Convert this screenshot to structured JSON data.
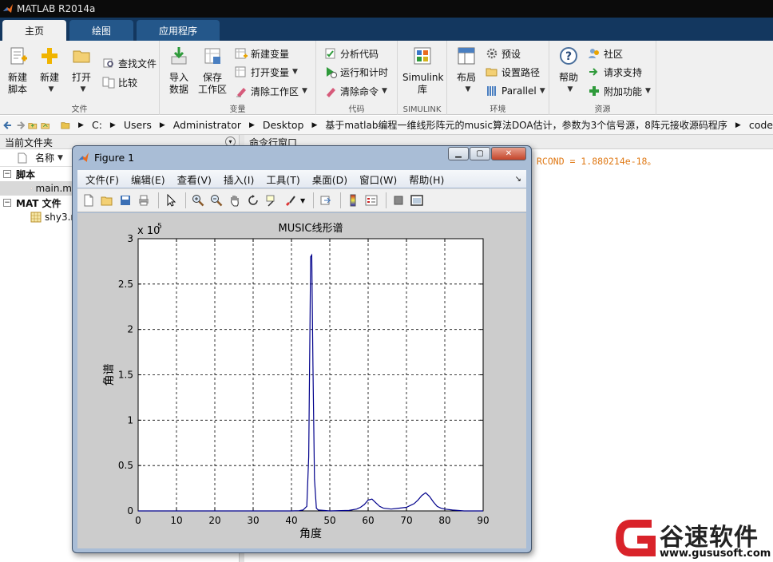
{
  "app": {
    "title": "MATLAB R2014a"
  },
  "tabs": [
    "主页",
    "绘图",
    "应用程序"
  ],
  "ribbon": {
    "file_group": {
      "title": "文件",
      "new_script": "新建\n脚本",
      "new": "新建",
      "open": "打开",
      "find_files": "查找文件",
      "compare": "比较"
    },
    "variable_group": {
      "title": "变量",
      "import": "导入\n数据",
      "save_workspace": "保存\n工作区",
      "new_variable": "新建变量",
      "open_variable": "打开变量",
      "clear_workspace": "清除工作区"
    },
    "code_group": {
      "title": "代码",
      "analyze": "分析代码",
      "run_time": "运行和计时",
      "clear_commands": "清除命令"
    },
    "simulink_group": {
      "title": "SIMULINK",
      "simulink_lib": "Simulink\n库"
    },
    "env_group": {
      "title": "环境",
      "layout": "布局",
      "prefs": "预设",
      "set_path": "设置路径",
      "parallel": "Parallel"
    },
    "res_group": {
      "title": "资源",
      "help": "帮助",
      "community": "社区",
      "support": "请求支持",
      "addons": "附加功能"
    }
  },
  "address": {
    "segments": [
      "C:",
      "Users",
      "Administrator",
      "Desktop",
      "基于matlab编程一维线形阵元的music算法DOA估计，参数为3个信号源，8阵元接收源码程序",
      "code"
    ]
  },
  "left_panel": {
    "title": "当前文件夹",
    "col_name": "名称",
    "groups": [
      {
        "label": "脚本",
        "files": [
          "main.m"
        ]
      },
      {
        "label": "MAT 文件",
        "files": [
          "shy3.mat"
        ]
      }
    ]
  },
  "command_window": {
    "title": "命令行窗口",
    "line": "RCOND =  1.880214e-18。"
  },
  "figure": {
    "title": "Figure 1",
    "menu": [
      "文件(F)",
      "编辑(E)",
      "查看(V)",
      "插入(I)",
      "工具(T)",
      "桌面(D)",
      "窗口(W)",
      "帮助(H)"
    ],
    "toolbar_icons": [
      "new-figure-icon",
      "open-icon",
      "save-icon",
      "print-icon",
      "pointer-icon",
      "zoom-in-icon",
      "zoom-out-icon",
      "pan-icon",
      "rotate-icon",
      "data-cursor-icon",
      "brush-icon",
      "link-icon",
      "colorbar-icon",
      "legend-icon",
      "hide-tools-icon",
      "dock-icon"
    ]
  },
  "chart_data": {
    "type": "line",
    "title": "MUSIC线形谱",
    "xlabel": "角度",
    "ylabel": "角谱",
    "exponent_label": "x 10",
    "exponent_power": "5",
    "xlim": [
      0,
      90
    ],
    "ylim": [
      0,
      3
    ],
    "xticks": [
      "0",
      "10",
      "20",
      "30",
      "40",
      "50",
      "60",
      "70",
      "80",
      "90"
    ],
    "yticks": [
      "0",
      "0.5",
      "1",
      "1.5",
      "2",
      "2.5",
      "3"
    ],
    "grid": true,
    "series": [
      {
        "color": "#00008b",
        "x": [
          0,
          20,
          40,
          42,
          43,
          44,
          44.5,
          45,
          45.3,
          45.6,
          46,
          46.5,
          47,
          50,
          55,
          57,
          58,
          59,
          60,
          61,
          62,
          63,
          64,
          66,
          68,
          70,
          71,
          72,
          73,
          74,
          75,
          76,
          77,
          78,
          79,
          80,
          82,
          85,
          90
        ],
        "y": [
          0.0,
          0.0,
          0.0,
          0.003,
          0.01,
          0.05,
          0.6,
          2.8,
          2.82,
          1.6,
          0.35,
          0.03,
          0.01,
          0.0,
          0.005,
          0.02,
          0.04,
          0.07,
          0.12,
          0.13,
          0.09,
          0.05,
          0.03,
          0.02,
          0.03,
          0.04,
          0.06,
          0.08,
          0.12,
          0.17,
          0.2,
          0.16,
          0.1,
          0.05,
          0.03,
          0.02,
          0.01,
          0.0,
          0.0
        ]
      }
    ]
  },
  "watermark": {
    "brand": "谷速软件",
    "url": "www.gususoft.com"
  }
}
